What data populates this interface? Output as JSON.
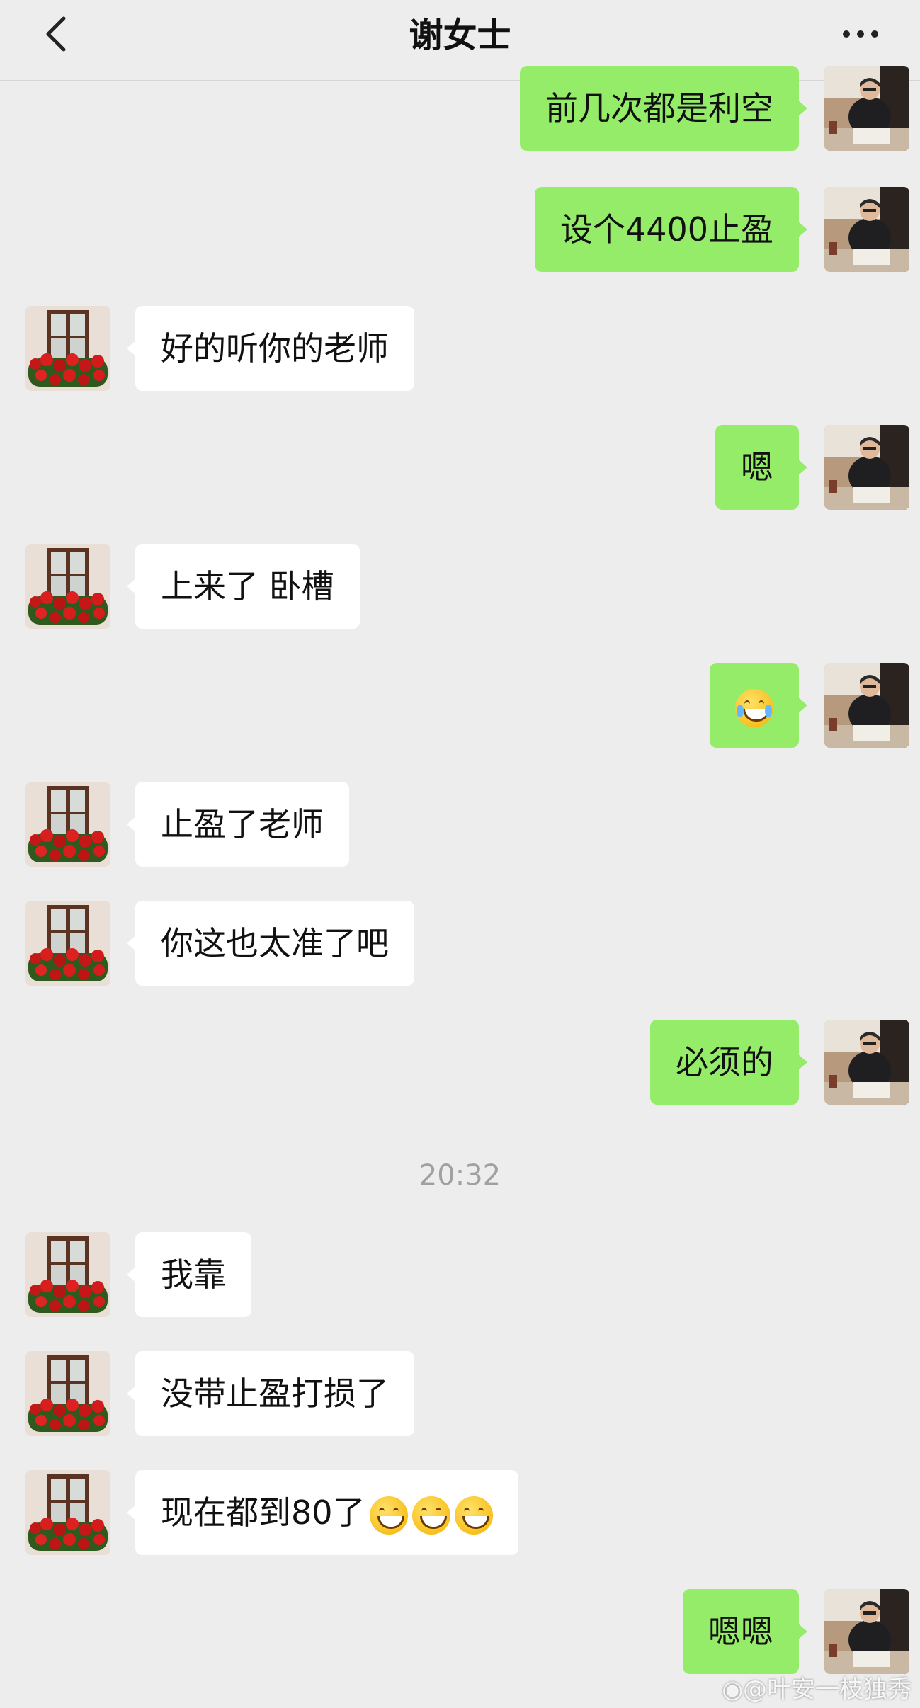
{
  "header": {
    "title": "谢女士",
    "back_icon": "chevron-left-icon",
    "more_icon": "more-dots-icon"
  },
  "messages": [
    {
      "side": "right",
      "text": "前几次都是利空"
    },
    {
      "side": "right",
      "text": "设个4400止盈"
    },
    {
      "side": "left",
      "text": "好的听你的老师"
    },
    {
      "side": "right",
      "text": "嗯"
    },
    {
      "side": "left",
      "text": "上来了 卧槽"
    },
    {
      "side": "right",
      "text": "",
      "emoji": [
        "tears-of-joy-emoji"
      ]
    },
    {
      "side": "left",
      "text": "止盈了老师"
    },
    {
      "side": "left",
      "text": "你这也太准了吧"
    },
    {
      "side": "right",
      "text": "必须的"
    },
    {
      "side": "left",
      "text": "我靠"
    },
    {
      "side": "left",
      "text": "没带止盈打损了"
    },
    {
      "side": "left",
      "text": "现在都到80了",
      "emoji": [
        "grin-emoji",
        "grin-emoji",
        "grin-emoji"
      ]
    },
    {
      "side": "right",
      "text": "嗯嗯"
    }
  ],
  "timestamp": "20:32",
  "watermark": "@叶安一枝独秀",
  "colors": {
    "background": "#ededed",
    "sent_bubble": "#95ec69",
    "received_bubble": "#ffffff",
    "timestamp": "#a0a0a0"
  }
}
